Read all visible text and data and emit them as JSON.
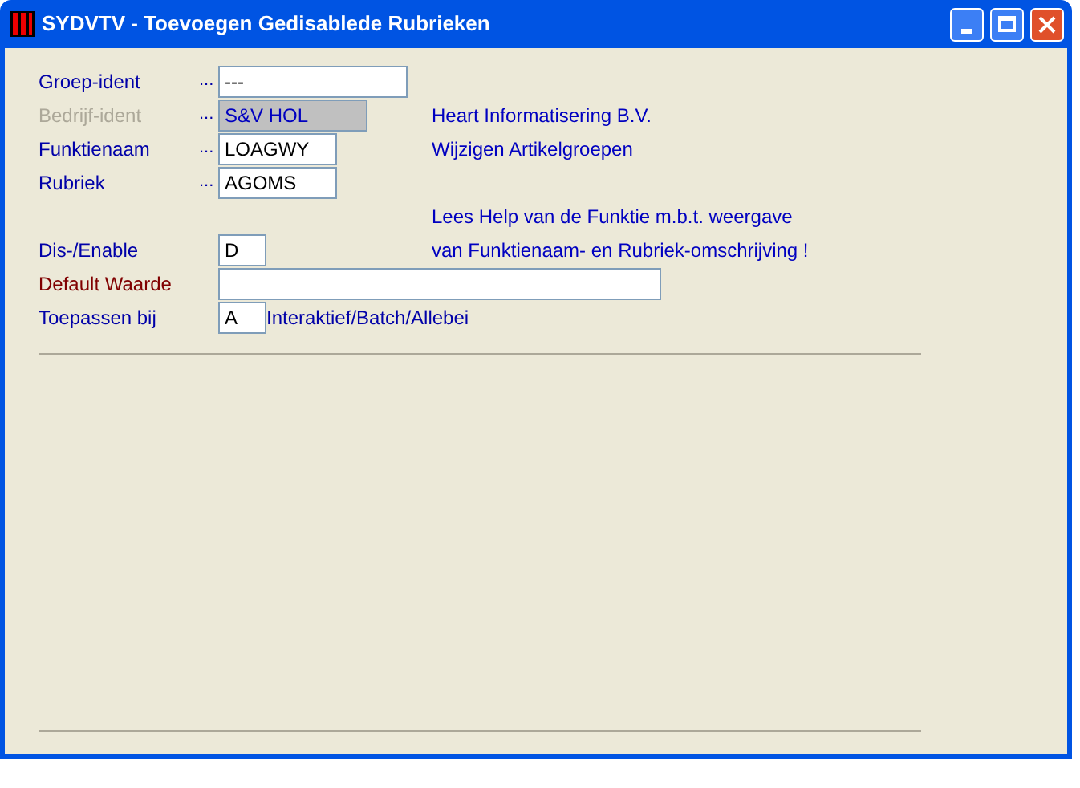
{
  "window": {
    "title": "SYDVTV - Toevoegen Gedisablede Rubrieken"
  },
  "rows": [
    {
      "kind": "field",
      "label": "Groep-ident",
      "color": "#0000a8",
      "dots": "...",
      "value": "---",
      "disabled": false
    },
    {
      "kind": "field",
      "label": "Bedrijf-ident",
      "color": "#aca899",
      "dots": "...",
      "value": "S&V HOL",
      "disabled": true,
      "note": "Heart Informatisering B.V."
    },
    {
      "kind": "field",
      "label": "Funktienaam",
      "color": "#0000a8",
      "dots": "...",
      "value": "LOAGWY",
      "disabled": false,
      "note": "Wijzigen Artikelgroepen"
    },
    {
      "kind": "field",
      "label": "Rubriek",
      "color": "#0000a8",
      "dots": "...",
      "value": "AGOMS",
      "disabled": false
    },
    {
      "kind": "note",
      "note": "Lees Help van de Funktie m.b.t. weergave"
    },
    {
      "kind": "field",
      "label": "Dis-/Enable",
      "color": "#0000a8",
      "value": "D",
      "disabled": false,
      "note": "van Funktienaam- en Rubriek-omschrijving !"
    },
    {
      "kind": "field",
      "label": "Default Waarde",
      "color": "#800000",
      "value": "",
      "disabled": false
    },
    {
      "kind": "field",
      "label": "Toepassen bij",
      "color": "#0000a8",
      "value": "A",
      "disabled": false,
      "suffix": "Interaktief/Batch/Allebei"
    }
  ]
}
